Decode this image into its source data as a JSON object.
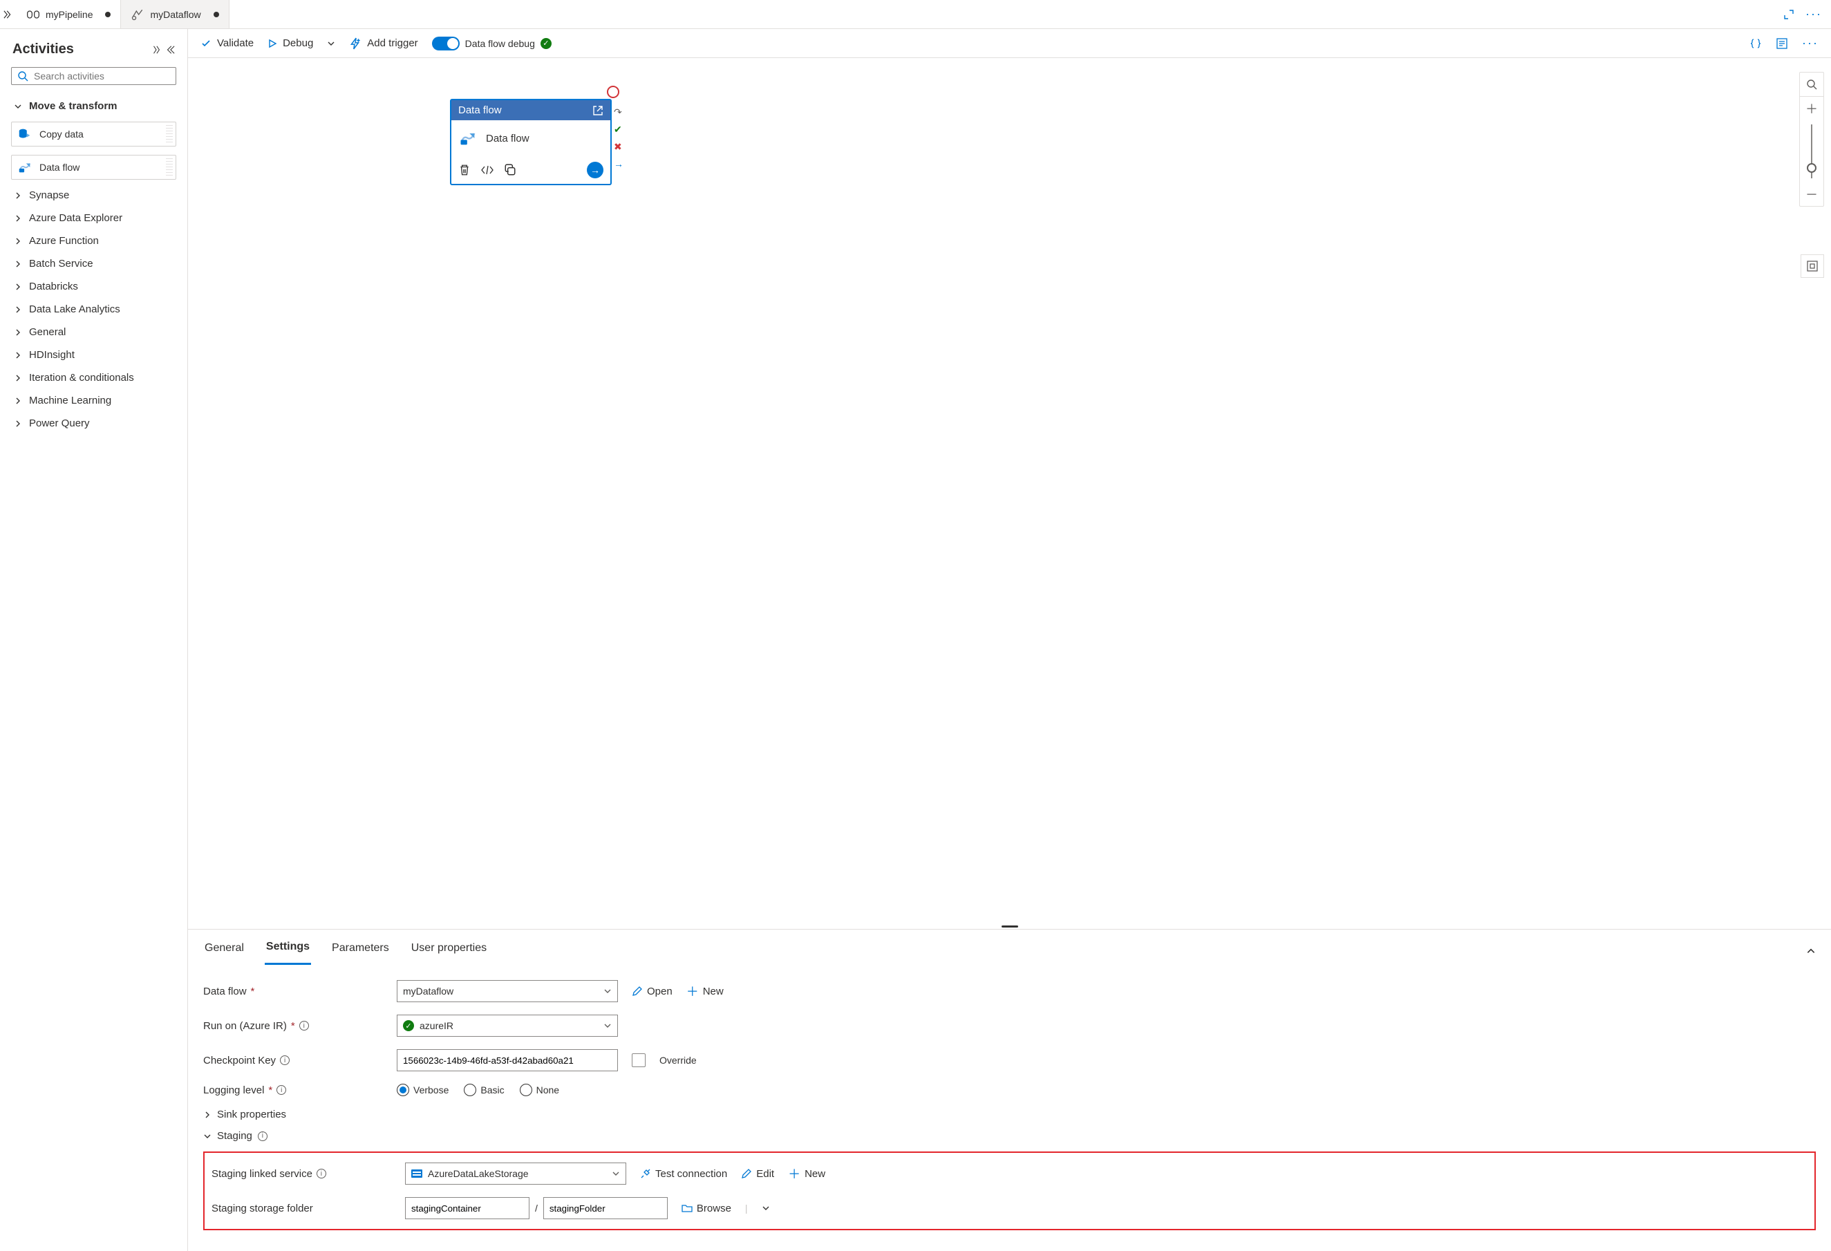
{
  "tabs": {
    "pipeline": "myPipeline",
    "dataflow": "myDataflow"
  },
  "sidebar": {
    "title": "Activities",
    "search_placeholder": "Search activities",
    "move_transform": "Move & transform",
    "copy_data": "Copy data",
    "data_flow": "Data flow",
    "categories": {
      "synapse": "Synapse",
      "ade": "Azure Data Explorer",
      "af": "Azure Function",
      "batch": "Batch Service",
      "databricks": "Databricks",
      "dla": "Data Lake Analytics",
      "general": "General",
      "hdi": "HDInsight",
      "iter": "Iteration & conditionals",
      "ml": "Machine Learning",
      "pq": "Power Query"
    }
  },
  "toolbar": {
    "validate": "Validate",
    "debug": "Debug",
    "add_trigger": "Add trigger",
    "debug_toggle": "Data flow debug"
  },
  "node": {
    "type": "Data flow",
    "name": "Data flow"
  },
  "panel": {
    "tabs": {
      "general": "General",
      "settings": "Settings",
      "parameters": "Parameters",
      "user": "User properties"
    },
    "labels": {
      "data_flow": "Data flow",
      "run_on": "Run on (Azure IR)",
      "checkpoint": "Checkpoint Key",
      "logging": "Logging level",
      "sink": "Sink properties",
      "staging": "Staging",
      "staging_ls": "Staging linked service",
      "staging_folder": "Staging storage folder"
    },
    "values": {
      "data_flow": "myDataflow",
      "run_on": "azureIR",
      "checkpoint": "1566023c-14b9-46fd-a53f-d42abad60a21",
      "staging_ls": "AzureDataLakeStorage",
      "staging_container": "stagingContainer",
      "staging_folder": "stagingFolder"
    },
    "actions": {
      "open": "Open",
      "new": "New",
      "override": "Override",
      "test_conn": "Test connection",
      "edit": "Edit",
      "browse": "Browse"
    },
    "logging": {
      "verbose": "Verbose",
      "basic": "Basic",
      "none": "None"
    }
  }
}
